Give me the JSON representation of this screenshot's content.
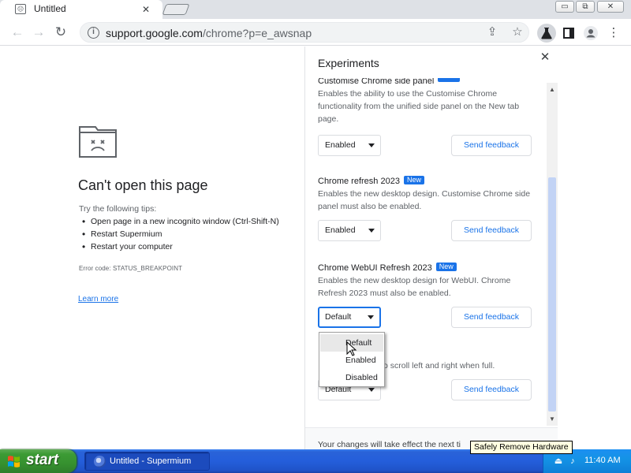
{
  "browser": {
    "tab_title": "Untitled",
    "tab_close_glyph": "✕",
    "window_buttons": {
      "minimize": "▭",
      "restore": "⧉",
      "close": "✕"
    },
    "url_host": "support.google.com",
    "url_path": "/chrome?p=e_awsnap",
    "icons": [
      "back-arrow-icon",
      "forward-arrow-icon",
      "reload-icon",
      "info-icon",
      "share-icon",
      "bookmark-star-icon",
      "labs-flask-icon",
      "side-panel-icon",
      "profile-icon",
      "menu-dots-icon"
    ]
  },
  "error_page": {
    "title": "Can't open this page",
    "tips_label": "Try the following tips:",
    "tips": [
      "Open page in a new incognito window (Ctrl-Shift-N)",
      "Restart Supermium",
      "Restart your computer"
    ],
    "error_code": "Error code: STATUS_BREAKPOINT",
    "learn_more": "Learn more"
  },
  "side_panel": {
    "title": "Experiments",
    "experiments": [
      {
        "name": "Customise Chrome side panel",
        "badge": "",
        "description": "Enables the ability to use the Customise Chrome functionality from the unified side panel on the New tab page.",
        "value": "Enabled",
        "feedback": "Send feedback"
      },
      {
        "name": "Chrome refresh 2023",
        "badge": "New",
        "description": "Enables the new desktop design. Customise Chrome side panel must also be enabled.",
        "value": "Enabled",
        "feedback": "Send feedback"
      },
      {
        "name": "Chrome WebUI Refresh 2023",
        "badge": "New",
        "description": "Enables the new desktop design for WebUI. Chrome Refresh 2023 must also be enabled.",
        "value": "Default",
        "feedback": "Send feedback"
      },
      {
        "name": "",
        "badge": "",
        "description": "o scroll left and right when full.",
        "value": "Default",
        "feedback": "Send feedback"
      }
    ],
    "dropdown_options": [
      "Default",
      "Enabled",
      "Disabled"
    ],
    "dropdown_hovered": "Default",
    "footer": "Your changes will take effect the next ti"
  },
  "tooltip": "Safely Remove Hardware",
  "taskbar": {
    "start_label": "start",
    "task_label": "Untitled - Supermium",
    "clock": "11:40 AM"
  },
  "colors": {
    "accent": "#1a73e8",
    "taskbar_blue": "#245edb",
    "start_green": "#36912f"
  }
}
